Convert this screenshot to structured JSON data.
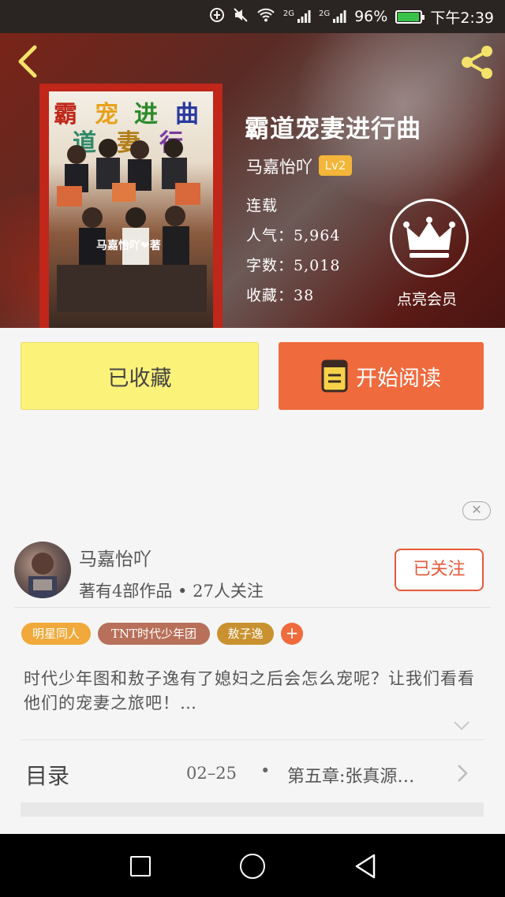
{
  "status_bar": {
    "network_1": "2G",
    "network_2": "2G",
    "battery_percent": "96%",
    "battery_level": 0.96,
    "time": "下午2:39"
  },
  "book": {
    "title": "霸道宠妻进行曲",
    "author": "马嘉怡吖",
    "level_badge": "Lv2",
    "status": "连载",
    "popularity_label": "人气：",
    "popularity_value": "5,964",
    "words_label": "字数：",
    "words_value": "5,018",
    "favorites_label": "收藏：",
    "favorites_value": "38",
    "cover": {
      "title_chars": [
        "霸",
        "宠",
        "进",
        "曲",
        "道",
        "妻",
        "行"
      ],
      "signature": "马嘉怡吖❤著"
    }
  },
  "vip": {
    "label": "点亮会员"
  },
  "actions": {
    "collected_label": "已收藏",
    "read_label": "开始阅读"
  },
  "ad_close": {
    "symbol": "✕"
  },
  "author_section": {
    "name": "马嘉怡吖",
    "stats": "著有4部作品 • 27人关注",
    "follow_label": "已关注"
  },
  "tags": [
    {
      "label": "明星同人",
      "color": "#f0a93a"
    },
    {
      "label": "TNT时代少年团",
      "color": "#b8705a"
    },
    {
      "label": "敖子逸",
      "color": "#c9912f"
    }
  ],
  "tag_add": "+",
  "description": "时代少年图和敖子逸有了媳妇之后会怎么宠呢？让我们看看他们的宠妻之旅吧！…",
  "toc": {
    "label": "目录",
    "date": "02–25",
    "dot": "•",
    "latest_chapter": "第五章:张真源…"
  },
  "colors": {
    "accent_orange": "#ef6a3d",
    "collected_yellow": "#fbf27a",
    "cover_red": "#c0261a",
    "follow_red": "#e6593a"
  }
}
